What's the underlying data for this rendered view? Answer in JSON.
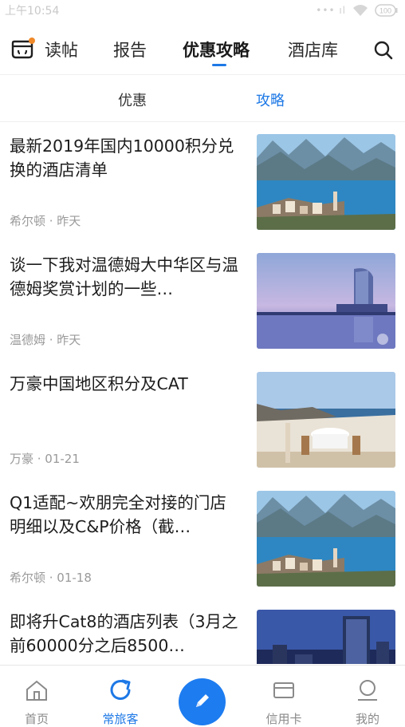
{
  "status_bar": {
    "time": "上午10:54",
    "battery": "100"
  },
  "nav": {
    "tabs": [
      {
        "label": "读帖"
      },
      {
        "label": "报告"
      },
      {
        "label": "优惠攻略"
      },
      {
        "label": "酒店库"
      }
    ],
    "active_index": 2
  },
  "sub_tabs": [
    {
      "label": "优惠"
    },
    {
      "label": "攻略"
    }
  ],
  "sub_active_index": 1,
  "articles": [
    {
      "title": "最新2019年国内10000积分兑换的酒店清单",
      "meta": "希尔顿 · 昨天",
      "thumb": "lake-town"
    },
    {
      "title": "谈一下我对温德姆大中华区与温德姆奖赏计划的一些…",
      "meta": "温德姆 · 昨天",
      "thumb": "tower-night"
    },
    {
      "title": "万豪中国地区积分及CAT",
      "meta": "万豪 · 01-21",
      "thumb": "terrace-sea"
    },
    {
      "title": "Q1适配~欢朋完全对接的门店明细以及C&P价格（截…",
      "meta": "希尔顿 · 01-18",
      "thumb": "lake-town"
    },
    {
      "title": "即将升Cat8的酒店列表（3月之前60000分之后8500…",
      "meta": "",
      "thumb": "city-night"
    }
  ],
  "bottom_nav": [
    {
      "label": "首页",
      "icon": "home-icon"
    },
    {
      "label": "常旅客",
      "icon": "refresh-icon"
    },
    {
      "label": "",
      "icon": "pencil-icon"
    },
    {
      "label": "信用卡",
      "icon": "card-icon"
    },
    {
      "label": "我的",
      "icon": "user-icon"
    }
  ],
  "colors": {
    "accent": "#1d78e6",
    "fab": "#1d7cf0",
    "meta": "#9a9a9a",
    "logo_dot": "#f08a2a"
  }
}
